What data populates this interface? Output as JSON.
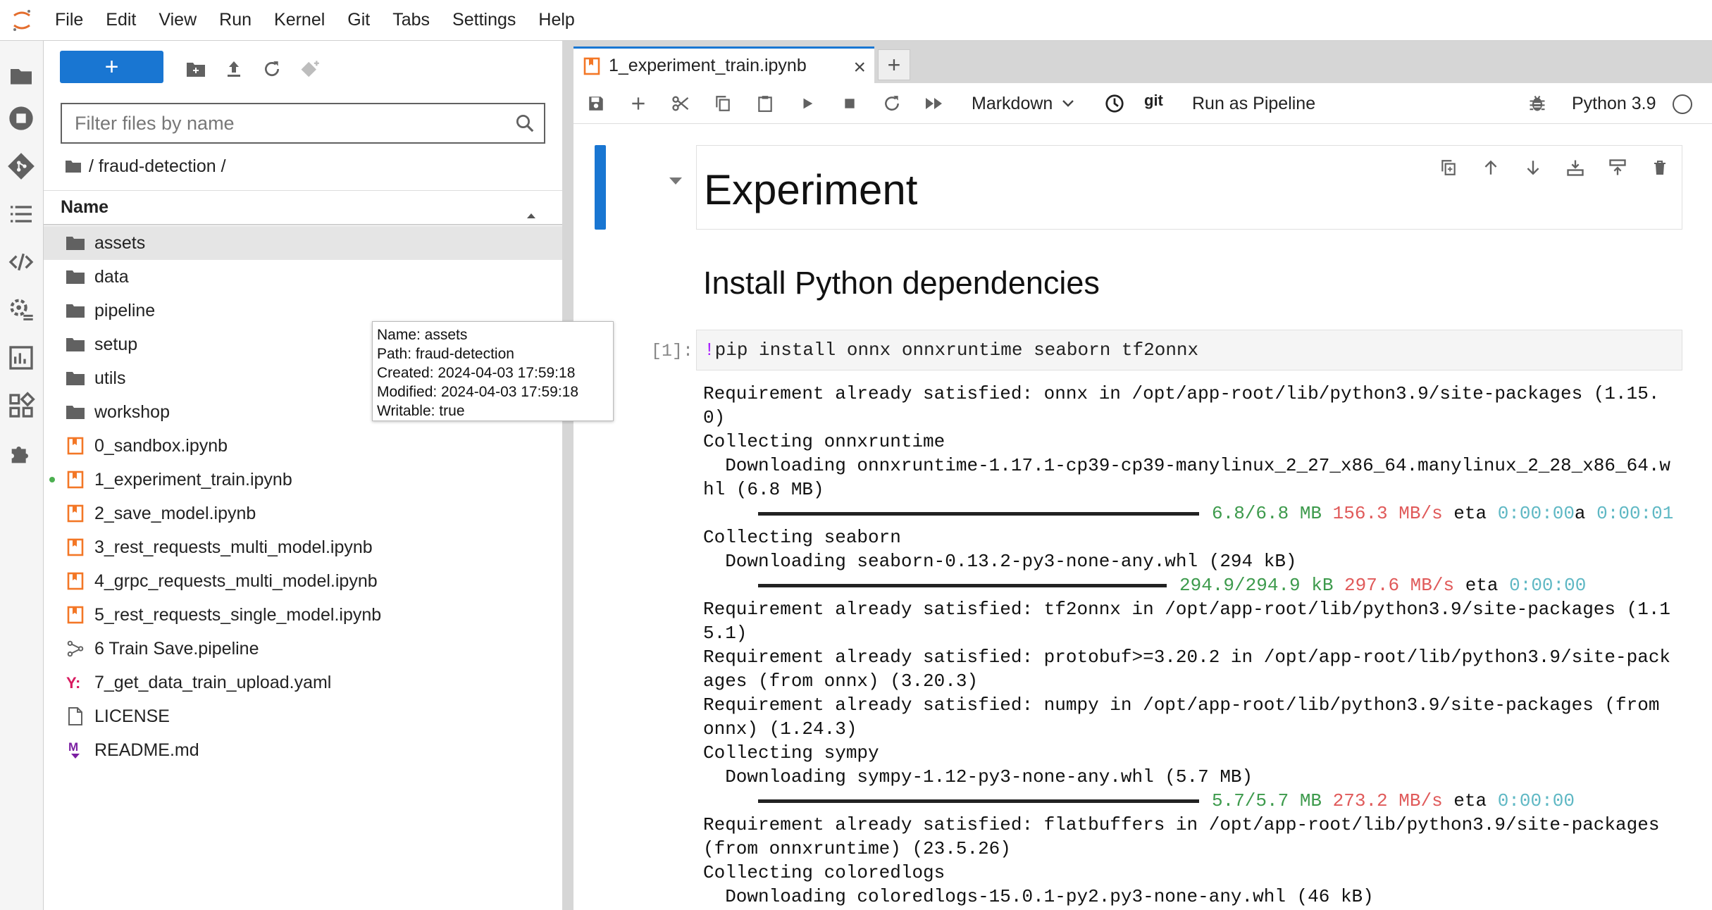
{
  "menubar": {
    "items": [
      "File",
      "Edit",
      "View",
      "Run",
      "Kernel",
      "Git",
      "Tabs",
      "Settings",
      "Help"
    ]
  },
  "left_sidebar": {
    "icons": [
      "folder-icon",
      "running-icon",
      "git-icon",
      "toc-icon",
      "code-snippets-icon",
      "property-inspector-icon",
      "elyra-catalog-icon",
      "extensions-manager-icon",
      "puzzle-icon"
    ]
  },
  "file_browser": {
    "new_label": "+",
    "filter_placeholder": "Filter files by name",
    "breadcrumb": "/ fraud-detection /",
    "column_name": "Name",
    "files": [
      {
        "name": "assets",
        "type": "folder",
        "selected": true
      },
      {
        "name": "data",
        "type": "folder"
      },
      {
        "name": "pipeline",
        "type": "folder"
      },
      {
        "name": "setup",
        "type": "folder"
      },
      {
        "name": "utils",
        "type": "folder"
      },
      {
        "name": "workshop",
        "type": "folder"
      },
      {
        "name": "0_sandbox.ipynb",
        "type": "notebook"
      },
      {
        "name": "1_experiment_train.ipynb",
        "type": "notebook",
        "running": true
      },
      {
        "name": "2_save_model.ipynb",
        "type": "notebook"
      },
      {
        "name": "3_rest_requests_multi_model.ipynb",
        "type": "notebook"
      },
      {
        "name": "4_grpc_requests_multi_model.ipynb",
        "type": "notebook"
      },
      {
        "name": "5_rest_requests_single_model.ipynb",
        "type": "notebook"
      },
      {
        "name": "6 Train Save.pipeline",
        "type": "pipeline"
      },
      {
        "name": "7_get_data_train_upload.yaml",
        "type": "yaml"
      },
      {
        "name": "LICENSE",
        "type": "file"
      },
      {
        "name": "README.md",
        "type": "markdown"
      }
    ],
    "tooltip": {
      "name": "Name: assets",
      "path": "Path: fraud-detection",
      "created": "Created: 2024-04-03 17:59:18",
      "modified": "Modified: 2024-04-03 17:59:18",
      "writable": "Writable: true"
    }
  },
  "tab": {
    "title": "1_experiment_train.ipynb",
    "close": "×",
    "new_tab": "+"
  },
  "notebook_toolbar": {
    "cell_type": "Markdown",
    "git": "git",
    "run_pipeline": "Run as Pipeline",
    "kernel": "Python 3.9"
  },
  "notebook": {
    "heading1": "Experiment",
    "heading2": "Install Python dependencies",
    "prompt": "[1]:",
    "code_bang": "!",
    "code": "pip install onnx onnxruntime seaborn tf2onnx",
    "output": [
      {
        "text": "Requirement already satisfied: onnx in /opt/app-root/lib/python3.9/site-packages (1.15."
      },
      {
        "text": "0)"
      },
      {
        "text": "Collecting onnxruntime"
      },
      {
        "text": "  Downloading onnxruntime-1.17.1-cp39-cp39-manylinux_2_27_x86_64.manylinux_2_28_x86_64.w"
      },
      {
        "text": "hl (6.8 MB)"
      },
      {
        "progress": true,
        "size": "6.8/6.8 MB",
        "speed": "156.3 MB/s",
        "eta_label": "eta",
        "eta": "0:00:00",
        "extra_char": "a",
        "eta2": "0:00:01"
      },
      {
        "text": "Collecting seaborn"
      },
      {
        "text": "  Downloading seaborn-0.13.2-py3-none-any.whl (294 kB)"
      },
      {
        "progress": true,
        "short": true,
        "size": "294.9/294.9 kB",
        "speed": "297.6 MB/s",
        "eta_label": "eta",
        "eta": "0:00:00"
      },
      {
        "text": "Requirement already satisfied: tf2onnx in /opt/app-root/lib/python3.9/site-packages (1.1"
      },
      {
        "text": "5.1)"
      },
      {
        "text": "Requirement already satisfied: protobuf>=3.20.2 in /opt/app-root/lib/python3.9/site-pack"
      },
      {
        "text": "ages (from onnx) (3.20.3)"
      },
      {
        "text": "Requirement already satisfied: numpy in /opt/app-root/lib/python3.9/site-packages (from"
      },
      {
        "text": "onnx) (1.24.3)"
      },
      {
        "text": "Collecting sympy"
      },
      {
        "text": "  Downloading sympy-1.12-py3-none-any.whl (5.7 MB)"
      },
      {
        "progress": true,
        "size": "5.7/5.7 MB",
        "speed": "273.2 MB/s",
        "eta_label": "eta",
        "eta": "0:00:00"
      },
      {
        "text": "Requirement already satisfied: flatbuffers in /opt/app-root/lib/python3.9/site-packages"
      },
      {
        "text": "(from onnxruntime) (23.5.26)"
      },
      {
        "text": "Collecting coloredlogs"
      },
      {
        "text": "  Downloading coloredlogs-15.0.1-py2.py3-none-any.whl (46 kB)"
      }
    ]
  }
}
